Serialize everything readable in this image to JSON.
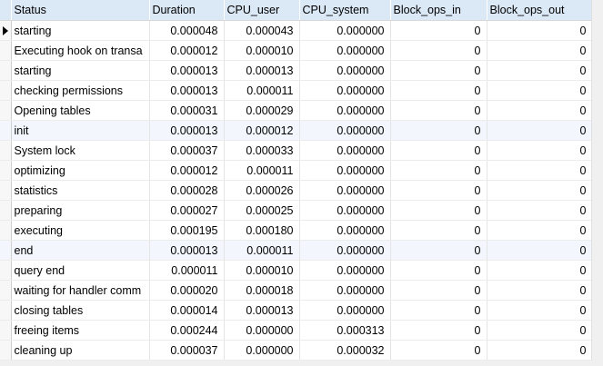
{
  "table": {
    "columns": [
      "Status",
      "Duration",
      "CPU_user",
      "CPU_system",
      "Block_ops_in",
      "Block_ops_out"
    ],
    "rows": [
      [
        "starting",
        "0.000048",
        "0.000043",
        "0.000000",
        "0",
        "0"
      ],
      [
        "Executing hook on transa",
        "0.000012",
        "0.000010",
        "0.000000",
        "0",
        "0"
      ],
      [
        "starting",
        "0.000013",
        "0.000013",
        "0.000000",
        "0",
        "0"
      ],
      [
        "checking permissions",
        "0.000013",
        "0.000011",
        "0.000000",
        "0",
        "0"
      ],
      [
        "Opening tables",
        "0.000031",
        "0.000029",
        "0.000000",
        "0",
        "0"
      ],
      [
        "init",
        "0.000013",
        "0.000012",
        "0.000000",
        "0",
        "0"
      ],
      [
        "System lock",
        "0.000037",
        "0.000033",
        "0.000000",
        "0",
        "0"
      ],
      [
        "optimizing",
        "0.000012",
        "0.000011",
        "0.000000",
        "0",
        "0"
      ],
      [
        "statistics",
        "0.000028",
        "0.000026",
        "0.000000",
        "0",
        "0"
      ],
      [
        "preparing",
        "0.000027",
        "0.000025",
        "0.000000",
        "0",
        "0"
      ],
      [
        "executing",
        "0.000195",
        "0.000180",
        "0.000000",
        "0",
        "0"
      ],
      [
        "end",
        "0.000013",
        "0.000011",
        "0.000000",
        "0",
        "0"
      ],
      [
        "query end",
        "0.000011",
        "0.000010",
        "0.000000",
        "0",
        "0"
      ],
      [
        "waiting for handler comm",
        "0.000020",
        "0.000018",
        "0.000000",
        "0",
        "0"
      ],
      [
        "closing tables",
        "0.000014",
        "0.000013",
        "0.000000",
        "0",
        "0"
      ],
      [
        "freeing items",
        "0.000244",
        "0.000000",
        "0.000313",
        "0",
        "0"
      ],
      [
        "cleaning up",
        "0.000037",
        "0.000000",
        "0.000032",
        "0",
        "0"
      ]
    ]
  }
}
